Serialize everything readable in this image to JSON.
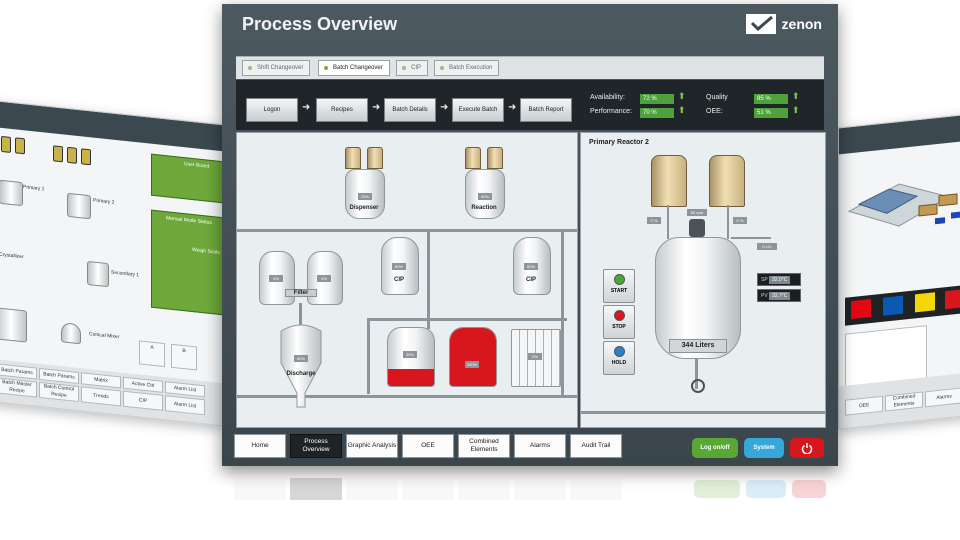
{
  "window": {
    "title": "Process Overview",
    "brand": "zenon"
  },
  "tabs": [
    {
      "label": "Shift Changeover",
      "active": false
    },
    {
      "label": "Batch Changeover",
      "active": true
    },
    {
      "label": "CIP",
      "active": false
    },
    {
      "label": "Batch Execution",
      "active": false
    }
  ],
  "workflow": [
    "Logon",
    "Recipes",
    "Batch Details",
    "Execute Batch",
    "Batch Report"
  ],
  "kpis": [
    {
      "label": "Availability:",
      "value": "72 %"
    },
    {
      "label": "Performance:",
      "value": "70 %"
    },
    {
      "label": "Quality",
      "value": "85 %"
    },
    {
      "label": "OEE:",
      "value": "51 %"
    }
  ],
  "plant": {
    "dispenser": {
      "label": "Dispenser",
      "level": "25%"
    },
    "reaction": {
      "label": "Reaction",
      "level": "60%"
    },
    "filter": {
      "label": "Filter",
      "left": "0%",
      "right": "0%"
    },
    "cip1": {
      "label": "CIP",
      "level": "80%"
    },
    "cip2": {
      "label": "CIP",
      "level": "60%"
    },
    "discharge": {
      "label": "Discharge",
      "level": "80%"
    },
    "ibc": [
      {
        "level": "30%",
        "fill": 0.3
      },
      {
        "level": "100%",
        "fill": 1.0
      },
      {
        "level": "0%",
        "fill": 0.0
      }
    ]
  },
  "reactor": {
    "title": "Primary Reactor 2",
    "volume": "344 Liters",
    "sp": {
      "label": "SP",
      "value": "32.0°C"
    },
    "pv": {
      "label": "PV",
      "value": "32.7°C"
    },
    "motor": "60 rpm",
    "controls": [
      "START",
      "STOP",
      "HOLD"
    ],
    "small_tags": [
      "0 %",
      "0 %",
      "0 L/h",
      "0 L/h"
    ]
  },
  "nav": [
    "Home",
    "Process Overview",
    "Graphic Analysis",
    "OEE",
    "Combined Elements",
    "Alarms",
    "Audit Trail"
  ],
  "actions": {
    "log": "Log on/off",
    "system": "System",
    "power": "power-icon"
  },
  "colors": {
    "green": "#5aa833",
    "red": "#d7161e",
    "blue": "#35a7d9",
    "header": "#424e56"
  },
  "left_panel": {
    "items": [
      "Primary 1",
      "Primary 2",
      "Secondary 1",
      "Conical Mixer",
      "Crystallizer",
      "User Board",
      "Manual Mode Status",
      "Weigh Scale"
    ],
    "footer": [
      "Batch Master Recipe",
      "Batch Control Recipe",
      "Trends",
      "CIP",
      "Alarm List"
    ],
    "footer_top": [
      "Batch Params",
      "Batch Params",
      "Matrix",
      "Active Ctrl",
      "Alarm List"
    ]
  },
  "right_panel": {
    "footer": [
      "OEE",
      "Combined Elements",
      "Alarms"
    ]
  }
}
